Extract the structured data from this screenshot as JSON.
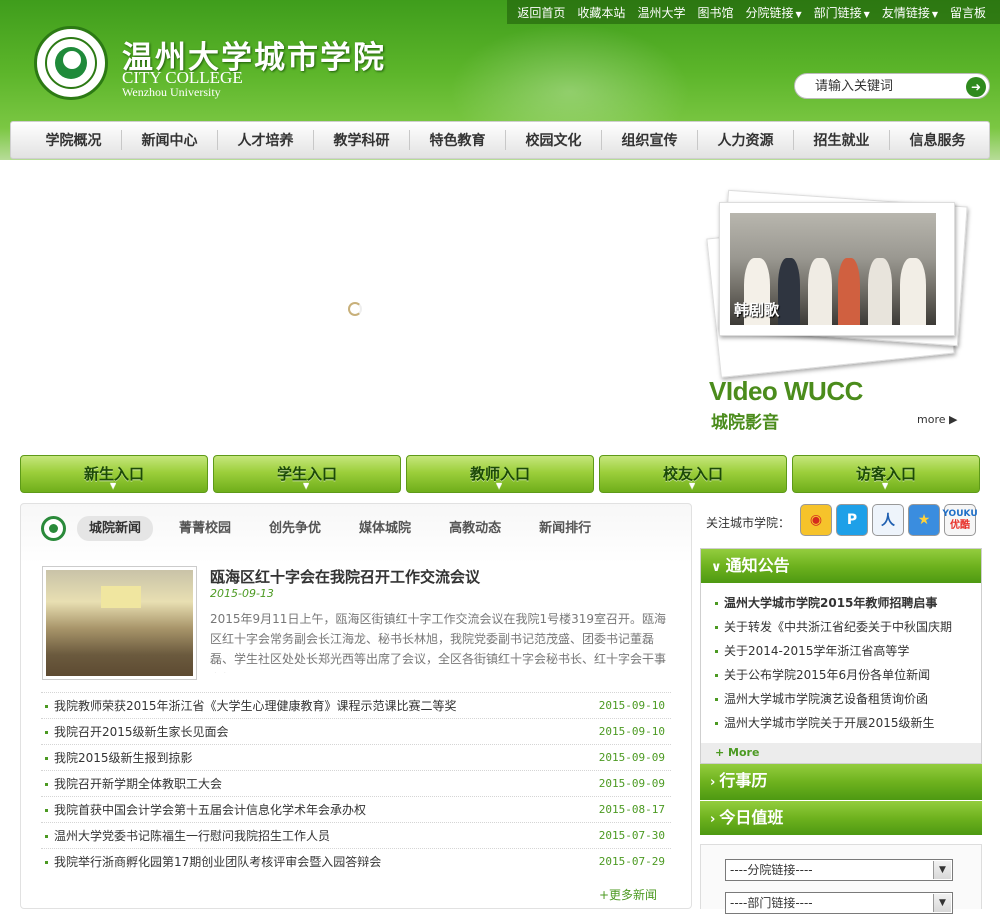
{
  "header": {
    "top_links": [
      "返回首页",
      "收藏本站",
      "温州大学",
      "图书馆",
      "分院链接",
      "部门链接",
      "友情链接",
      "留言板"
    ],
    "site_name_cn": "温州大学城市学院",
    "site_name_en1": "CITY COLLEGE",
    "site_name_en2": "Wenzhou University",
    "search_placeholder": "请输入关键词"
  },
  "nav": [
    "学院概况",
    "新闻中心",
    "人才培养",
    "教学科研",
    "特色教育",
    "校园文化",
    "组织宣传",
    "人力资源",
    "招生就业",
    "信息服务"
  ],
  "video": {
    "photo_caption": "韩剧歌",
    "title": "VIdeo WUCC",
    "subtitle": "城院影音",
    "more": "more"
  },
  "entries": [
    "新生入口",
    "学生入口",
    "教师入口",
    "校友入口",
    "访客入口"
  ],
  "news": {
    "tabs": [
      "城院新闻",
      "菁菁校园",
      "创先争优",
      "媒体城院",
      "高教动态",
      "新闻排行"
    ],
    "active_tab": "城院新闻",
    "headline": {
      "title": "瓯海区红十字会在我院召开工作交流会议",
      "date": "2015-09-13",
      "summary": "2015年9月11日上午，瓯海区街镇红十字工作交流会议在我院1号楼319室召开。瓯海区红十字会常务副会长江海龙、秘书长林旭，我院党委副书记范茂盛、团委书记董磊磊、学生社区处处长郑光西等出席了会议，全区各街镇红十字会秘书长、红十字会干事参加"
    },
    "items": [
      {
        "title": "我院教师荣获2015年浙江省《大学生心理健康教育》课程示范课比赛二等奖",
        "date": "2015-09-10"
      },
      {
        "title": "我院召开2015级新生家长见面会",
        "date": "2015-09-10"
      },
      {
        "title": "我院2015级新生报到掠影",
        "date": "2015-09-09"
      },
      {
        "title": "我院召开新学期全体教职工大会",
        "date": "2015-09-09"
      },
      {
        "title": "我院首获中国会计学会第十五届会计信息化学术年会承办权",
        "date": "2015-08-17"
      },
      {
        "title": "温州大学党委书记陈福生一行慰问我院招生工作人员",
        "date": "2015-07-30"
      },
      {
        "title": "我院举行浙商孵化园第17期创业团队考核评审会暨入园答辩会",
        "date": "2015-07-29"
      }
    ],
    "more": "+更多新闻"
  },
  "sidebar": {
    "follow_label": "关注城市学院：",
    "social": [
      "weibo-icon",
      "tencent-weibo-icon",
      "renren-icon",
      "favorite-star-icon",
      "youku-icon"
    ],
    "social_text": {
      "youku": "优酷"
    },
    "notice_title": "通知公告",
    "notices": [
      {
        "text": "温州大学城市学院2015年教师招聘启事",
        "bold": true
      },
      {
        "text": "关于转发《中共浙江省纪委关于中秋国庆期",
        "bold": false
      },
      {
        "text": "关于2014-2015学年浙江省高等学",
        "bold": false
      },
      {
        "text": "关于公布学院2015年6月份各单位新闻",
        "bold": false
      },
      {
        "text": "温州大学城市学院演艺设备租赁询价函",
        "bold": false
      },
      {
        "text": "温州大学城市学院关于开展2015级新生",
        "bold": false
      }
    ],
    "notice_more": "+ More",
    "calendar_title": "行事历",
    "duty_title": "今日值班",
    "select_college": "----分院链接----",
    "select_dept": "----部门链接----"
  },
  "colors": {
    "brand_green": "#5cb52a",
    "accent_green": "#4c9a22"
  }
}
